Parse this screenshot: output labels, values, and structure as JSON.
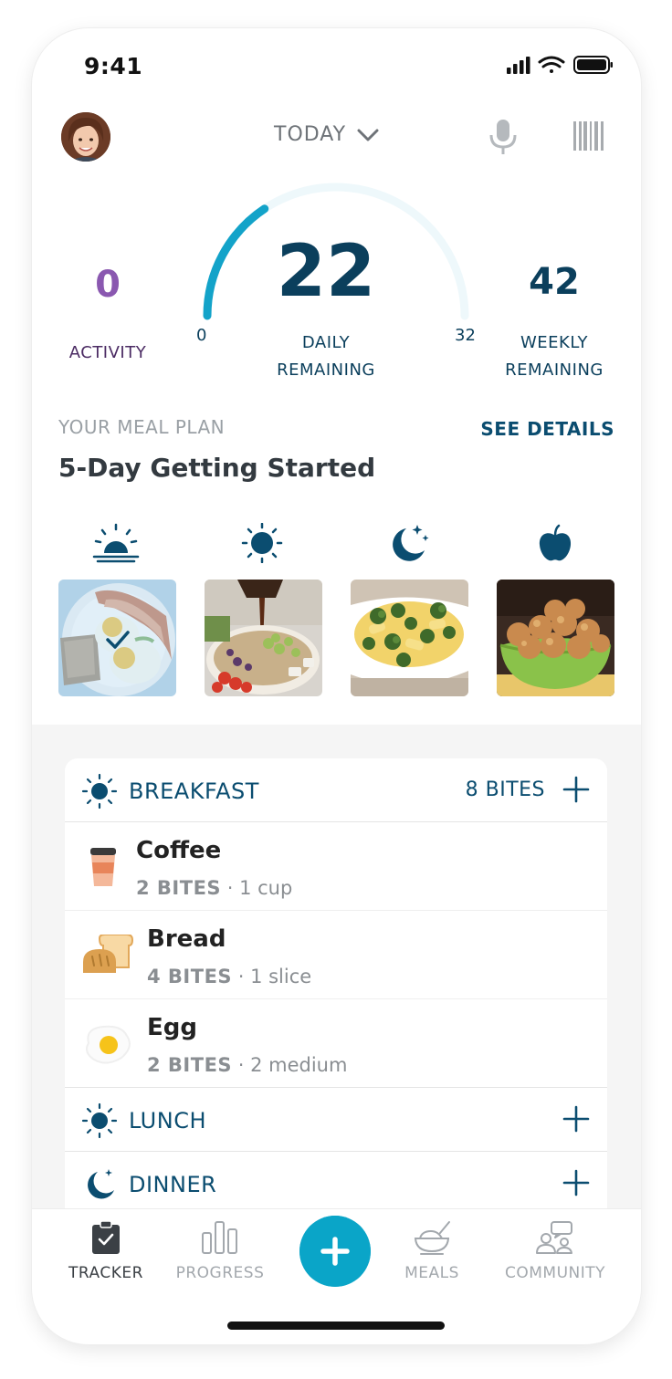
{
  "status_bar": {
    "time": "9:41"
  },
  "header": {
    "date_selector": "TODAY"
  },
  "stats": {
    "activity": {
      "value": "0",
      "label": "ACTIVITY"
    },
    "daily": {
      "value": "22",
      "label_line1": "DAILY",
      "label_line2": "REMAINING",
      "min": "0",
      "max": "32",
      "fraction_used": 0.3125
    },
    "weekly": {
      "value": "42",
      "label_line1": "WEEKLY",
      "label_line2": "REMAINING"
    }
  },
  "meal_plan": {
    "label": "YOUR MEAL PLAN",
    "details_link": "SEE DETAILS",
    "title": "5-Day Getting Started",
    "slots": [
      {
        "icon": "sunrise-icon",
        "photo": "eggs-bacon-toast-photo",
        "completed": true
      },
      {
        "icon": "sun-icon",
        "photo": "quinoa-salad-photo",
        "completed": false
      },
      {
        "icon": "moon-stars-icon",
        "photo": "pasta-broccoli-photo",
        "completed": false
      },
      {
        "icon": "apple-icon",
        "photo": "bites-bowl-photo",
        "completed": false
      }
    ]
  },
  "log": {
    "breakfast": {
      "label": "BREAKFAST",
      "bites": "8 BITES",
      "items": [
        {
          "name": "Coffee",
          "bites": "2 BITES",
          "portion": "1 cup",
          "icon": "coffee-cup-icon"
        },
        {
          "name": "Bread",
          "bites": "4 BITES",
          "portion": "1 slice",
          "icon": "bread-icon"
        },
        {
          "name": "Egg",
          "bites": "2 BITES",
          "portion": "2 medium",
          "icon": "fried-egg-icon"
        }
      ]
    },
    "lunch": {
      "label": "LUNCH"
    },
    "dinner": {
      "label": "DINNER"
    }
  },
  "tabs": {
    "tracker": "TRACKER",
    "progress": "PROGRESS",
    "meals": "MEALS",
    "community": "COMMUNITY",
    "active": "tracker"
  },
  "colors": {
    "brand_dark": "#0b3f5c",
    "accent": "#0aa5c8",
    "activity": "#8a58b0",
    "background": "#f5f5f5"
  }
}
